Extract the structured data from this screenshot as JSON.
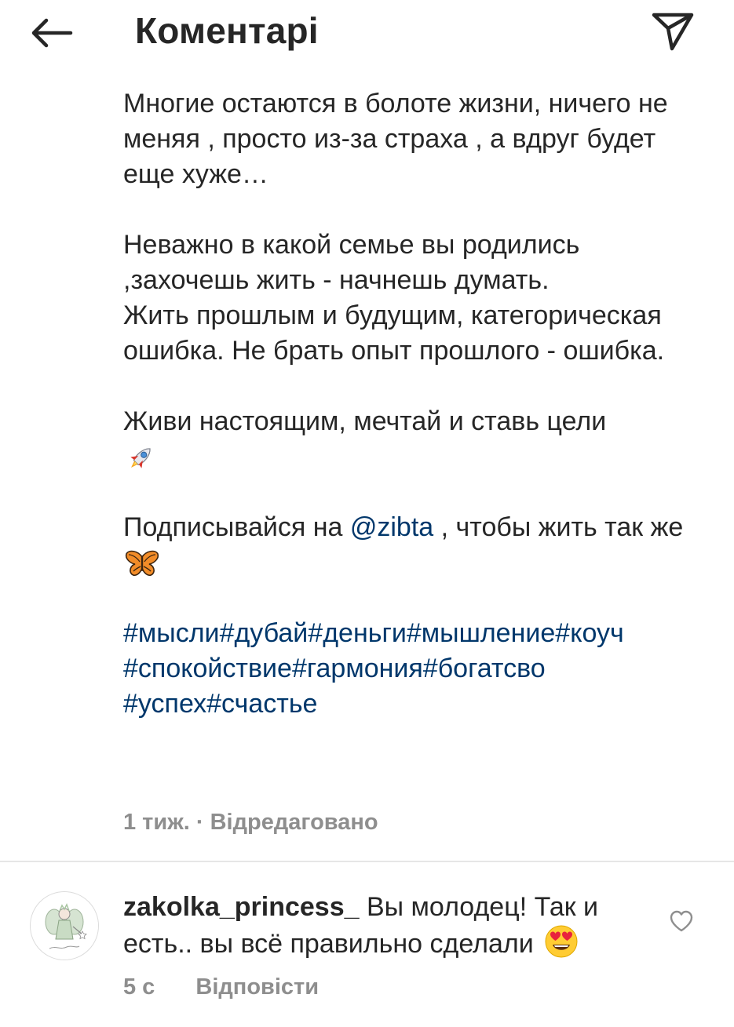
{
  "header": {
    "title": "Коментарі"
  },
  "caption": {
    "paragraphs": {
      "p1": "Многие остаются в болоте жизни, ничего не меняя , просто из-за страха , а вдруг будет еще хуже…",
      "p2": "Неважно в какой семье вы родились ,захочешь жить - начнешь думать.",
      "p3": "Жить прошлым и будущим, категорическая ошибка. Не брать опыт прошлого - ошибка.",
      "p4": "Живи настоящим, мечтай и ставь цели",
      "p5_before": "Подписывайся на ",
      "p5_mention": "@zibta",
      "p5_after": " , чтобы жить так же"
    },
    "hashtags": {
      "h1": "#мысли",
      "h2": "#дубай",
      "h3": "#деньги",
      "h4": "#мышление",
      "h5": "#коуч",
      "h6": "#спокойствие",
      "h7": "#гармония",
      "h8": "#богатсво",
      "h9": "#успех",
      "h10": "#счастье"
    },
    "meta": "1 тиж. · Відредаговано"
  },
  "comment": {
    "username": "zakolka_princess_",
    "text": "Вы молодец! Так и есть.. вы всё правильно сделали",
    "time": "5 с",
    "reply_label": "Відповісти"
  },
  "icons": {
    "back": "arrow-left-icon",
    "share": "paper-plane-icon",
    "rocket": "rocket-emoji",
    "butterfly": "butterfly-emoji",
    "heart_eyes": "heart-eyes-emoji",
    "like": "heart-outline-icon"
  },
  "colors": {
    "text": "#262626",
    "link": "#00376b",
    "muted": "#8e8e8e",
    "divider": "#e6e6e6"
  }
}
